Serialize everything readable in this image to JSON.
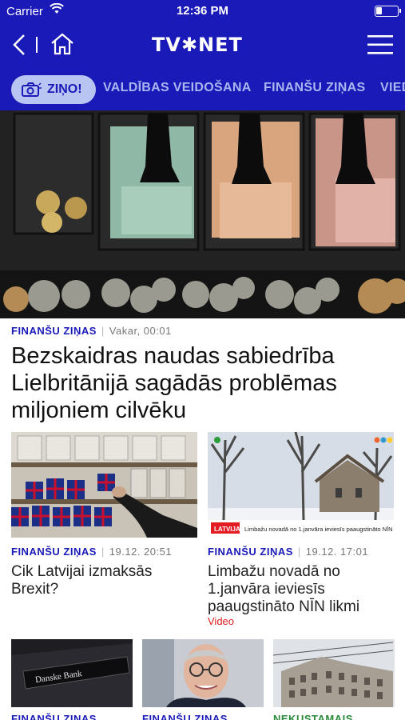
{
  "status": {
    "carrier": "Carrier",
    "time": "12:36 PM"
  },
  "nav": {
    "logo": "TV✱NET"
  },
  "tabs": {
    "pill": "ZIŅO!",
    "items": [
      "VALDĪBAS VEIDOŠANA",
      "FINANŠU ZIŅAS",
      "VIED"
    ]
  },
  "hero": {
    "category": "FINANŠU ZIŅAS",
    "date": "Vakar, 00:01",
    "title": "Bezskaidras naudas sabiedrība Lielbritānijā sagādās problēmas miljoniem cilvēku"
  },
  "cards": [
    {
      "category": "FINANŠU ZIŅAS",
      "date": "19.12. 20:51",
      "title": "Cik Latvijai izmaksās Brexit?"
    },
    {
      "category": "FINANŠU ZIŅAS",
      "date": "19.12. 17:01",
      "title": "Limbažu novadā no 1.janvāra ieviesīs paaugstināto NĪN likmi",
      "tag": "Video",
      "caption": "Limbažu novadā no 1.janvāra ieviesīs paaugstināto NĪN likmi"
    }
  ],
  "small_cards": [
    {
      "category": "FINANŠU ZIŅAS",
      "sign": "Danske Bank"
    },
    {
      "category": "FINANŠU ZIŅAS"
    },
    {
      "category": "NEKUSTAMAIS ĪPAŠUMS"
    }
  ]
}
